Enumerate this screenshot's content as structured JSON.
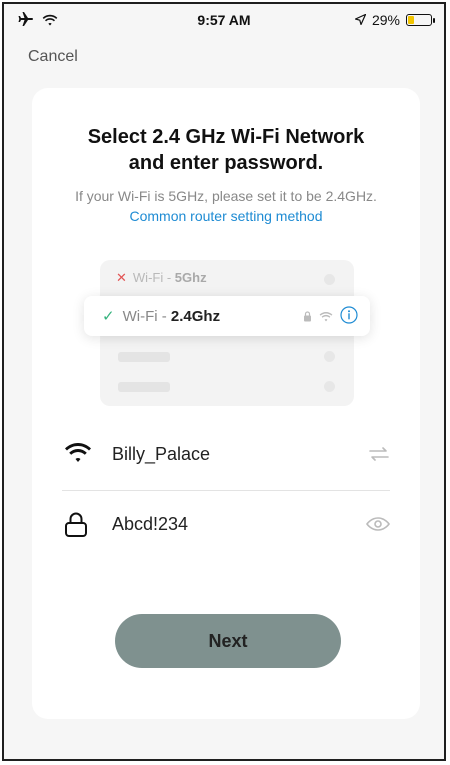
{
  "status_bar": {
    "time": "9:57 AM",
    "battery_text": "29%",
    "battery_level": 0.29,
    "icons": [
      "airplane-icon",
      "wifi-icon",
      "location-arrow-icon",
      "battery-icon"
    ]
  },
  "nav": {
    "cancel_label": "Cancel"
  },
  "header": {
    "title_line1": "Select 2.4 GHz Wi-Fi Network",
    "title_line2": "and enter password.",
    "subtitle_prefix": "If your Wi-Fi is 5GHz, please set it to be 2.4GHz.",
    "subtitle_link": "Common router setting method"
  },
  "illustration": {
    "net5_prefix": "Wi-Fi - ",
    "net5_band": "5Ghz",
    "net24_prefix": "Wi-Fi - ",
    "net24_band": "2.4Ghz"
  },
  "form": {
    "ssid_value": "Billy_Palace",
    "password_value": "Abcd!234"
  },
  "actions": {
    "next_label": "Next"
  },
  "colors": {
    "link": "#1e8bd3",
    "button": "#7f918f",
    "check": "#36b37e",
    "cross": "#e25555"
  }
}
